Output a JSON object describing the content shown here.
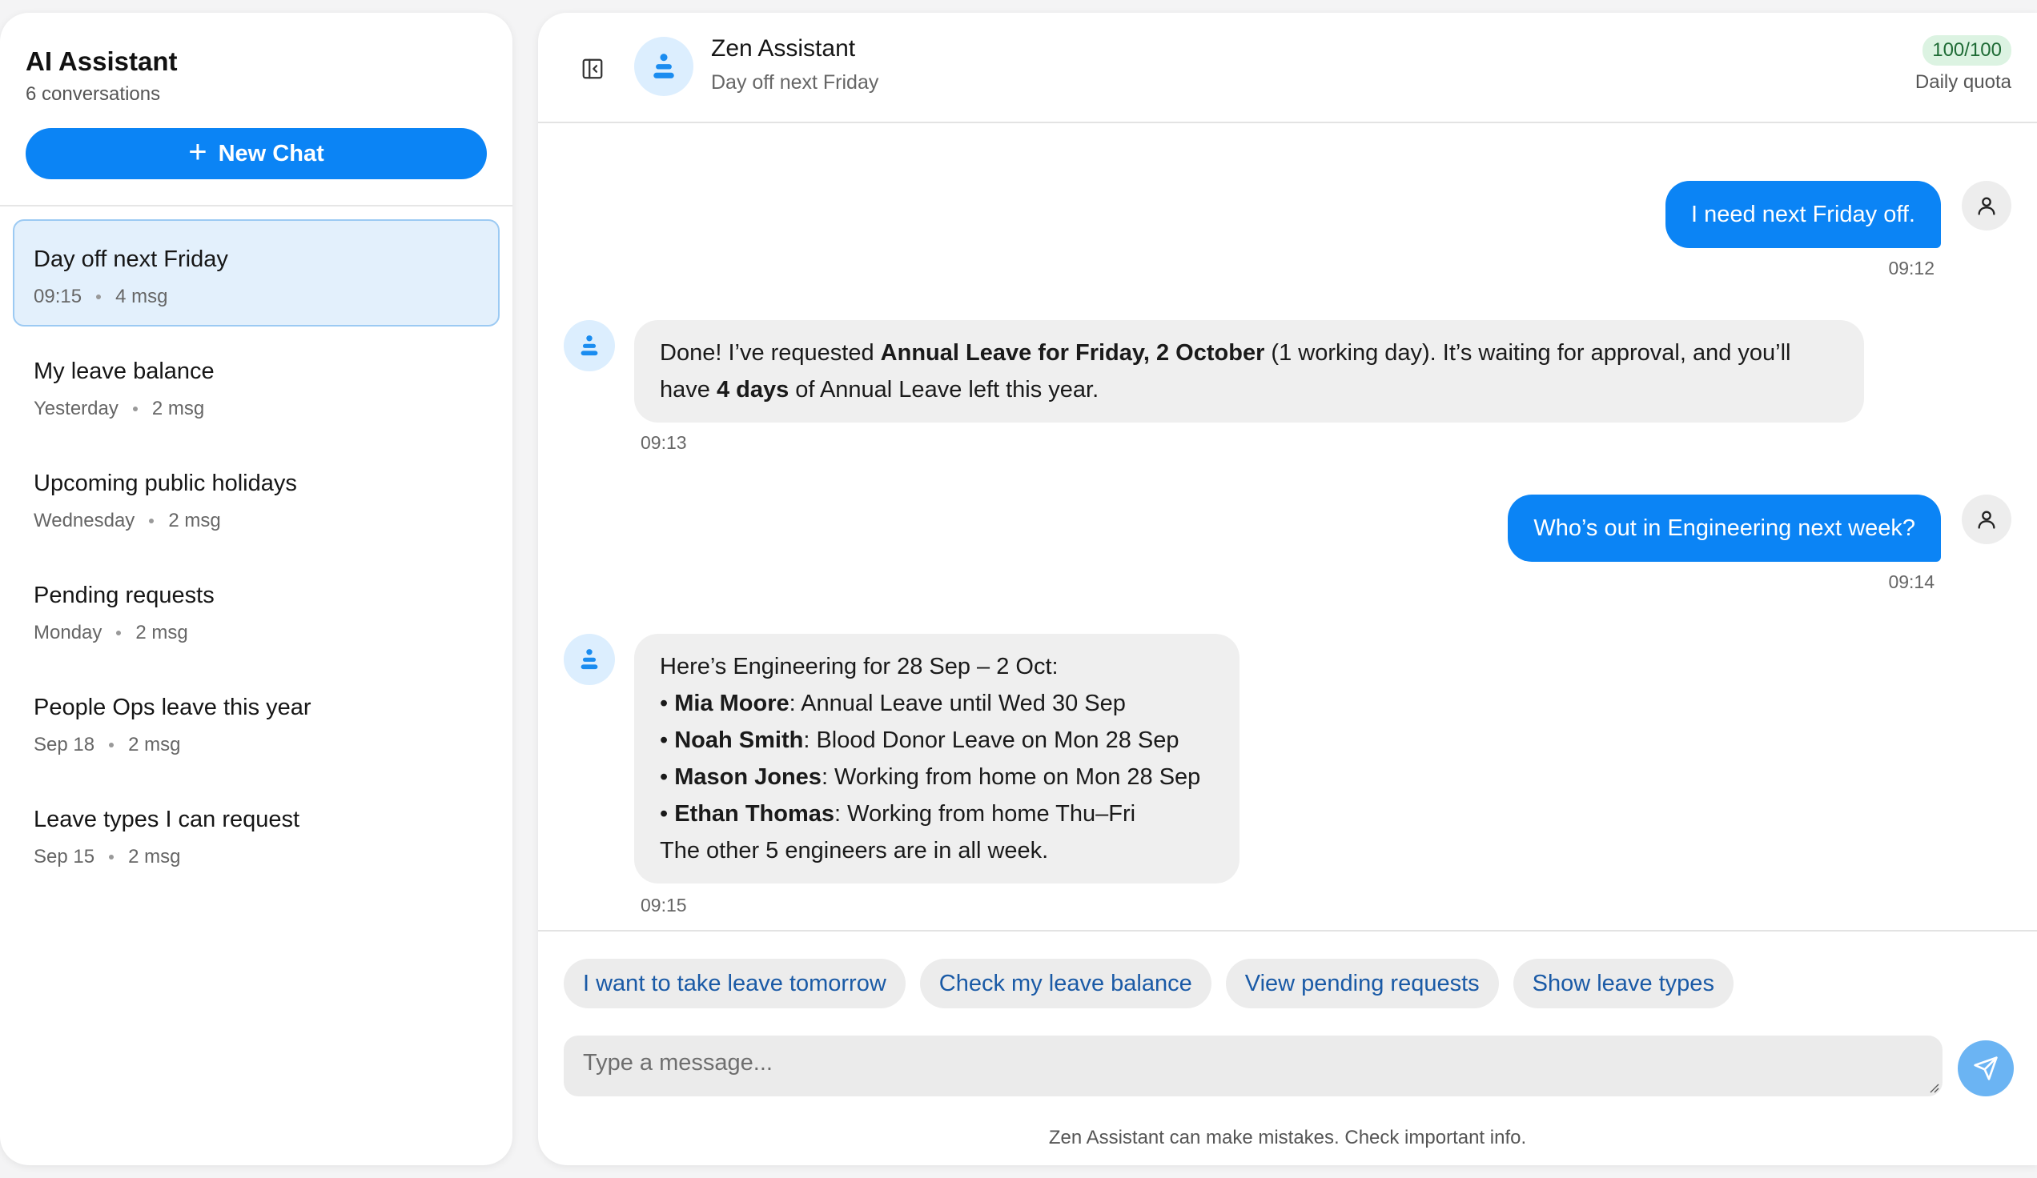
{
  "sidebar": {
    "title": "AI Assistant",
    "count": "6 conversations",
    "new_chat_label": "New Chat",
    "new_chat_icon": "plus-icon",
    "items": [
      {
        "title": "Day off next Friday",
        "time": "09:15",
        "count": "4 msg",
        "active": true
      },
      {
        "title": "My leave balance",
        "time": "Yesterday",
        "count": "2 msg"
      },
      {
        "title": "Upcoming public holidays",
        "time": "Wednesday",
        "count": "2 msg"
      },
      {
        "title": "Pending requests",
        "time": "Monday",
        "count": "2 msg"
      },
      {
        "title": "People Ops leave this year",
        "time": "Sep 18",
        "count": "2 msg"
      },
      {
        "title": "Leave types I can request",
        "time": "Sep 15",
        "count": "2 msg"
      }
    ]
  },
  "header": {
    "collapse_icon": "sidebar-collapse-icon",
    "bot_icon": "zen-bot-icon",
    "name": "Zen Assistant",
    "subtitle": "Day off next Friday",
    "quota_value": "100/100",
    "quota_label": "Daily quota"
  },
  "messages": [
    {
      "role": "user",
      "text": "I need next Friday off.",
      "time": "09:12"
    },
    {
      "role": "assistant",
      "time": "09:13",
      "parts": {
        "p1": "Done! I’ve requested ",
        "b1": "Annual Leave for Friday, 2 October",
        "p2": " (1 working day). It’s waiting for approval, and you’ll",
        "p3": "have ",
        "b2": "4 days",
        "p4": " of Annual Leave left this year."
      }
    },
    {
      "role": "user",
      "text": "Who’s out in Engineering next week?",
      "time": "09:14"
    },
    {
      "role": "assistant",
      "time": "09:15",
      "intro": "Here’s Engineering for 28 Sep – 2 Oct:",
      "bullets": [
        {
          "name": "Mia Moore",
          "detail": ": Annual Leave until Wed 30 Sep"
        },
        {
          "name": "Noah Smith",
          "detail": ": Blood Donor Leave on Mon 28 Sep"
        },
        {
          "name": "Mason Jones",
          "detail": ": Working from home on Mon 28 Sep"
        },
        {
          "name": "Ethan Thomas",
          "detail": ": Working from home Thu–Fri"
        }
      ],
      "outro": "The other 5 engineers are in all week."
    }
  ],
  "suggestions": [
    "I want to take leave tomorrow",
    "Check my leave balance",
    "View pending requests",
    "Show leave types"
  ],
  "composer": {
    "placeholder": "Type a message...",
    "value": "",
    "send_icon": "send-icon",
    "disclaimer": "Zen Assistant can make mistakes. Check important info."
  },
  "colors": {
    "accent": "#0b84f5",
    "send_button": "#6bb4f3",
    "active_item_bg": "#e3f0fc",
    "quota_badge_bg": "#dcf3e2",
    "quota_badge_text": "#1e6b35",
    "chip_text": "#1a5aa6"
  }
}
